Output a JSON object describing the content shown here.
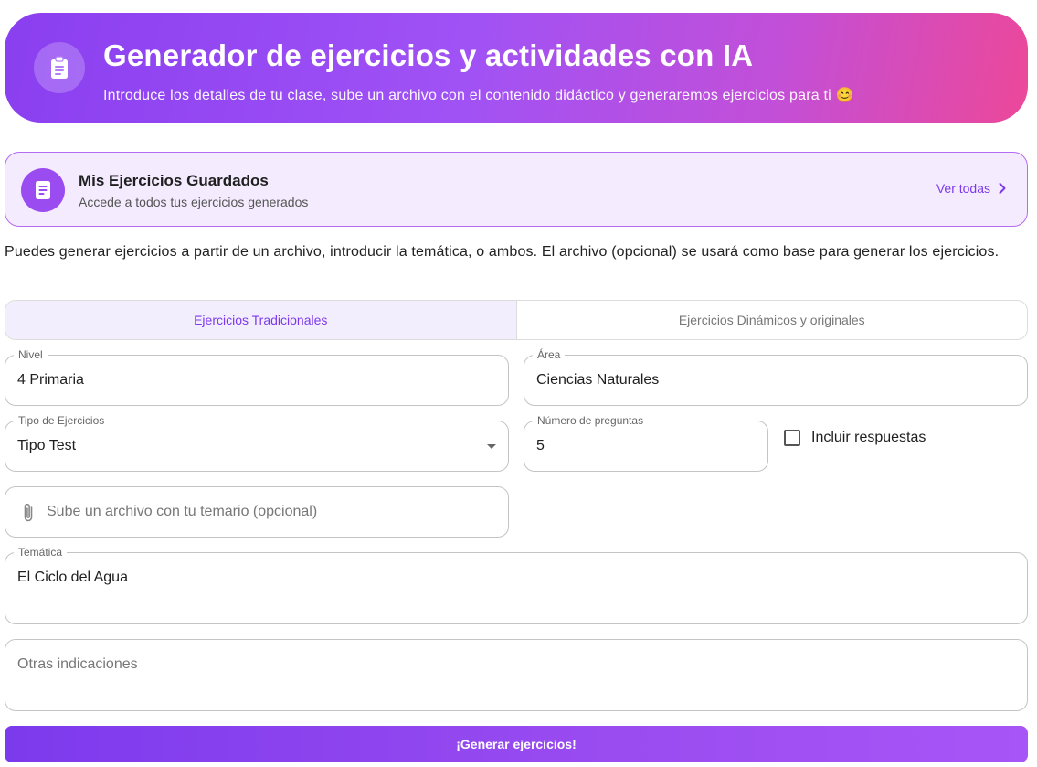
{
  "header": {
    "icon": "clipboard-icon",
    "title": "Generador de ejercicios y actividades con IA",
    "subtitle": "Introduce los detalles de tu clase, sube un archivo con el contenido didáctico y generaremos ejercicios para ti 😊",
    "gradient_start": "#8a3ff0",
    "gradient_end": "#ec4899"
  },
  "saved": {
    "icon": "document-icon",
    "title": "Mis Ejercicios Guardados",
    "subtitle": "Accede a todos tus ejercicios generados",
    "link_label": "Ver todas",
    "link_icon": "chevron-right-icon"
  },
  "intro_text": "Puedes generar ejercicios a partir de un archivo, introducir la temática, o ambos. El archivo (opcional) se usará como base para generar los ejercicios.",
  "tabs": [
    {
      "label": "Ejercicios Tradicionales",
      "active": true
    },
    {
      "label": "Ejercicios Dinámicos y originales",
      "active": false
    }
  ],
  "form": {
    "nivel": {
      "label": "Nivel",
      "value": "4 Primaria"
    },
    "area": {
      "label": "Área",
      "value": "Ciencias Naturales"
    },
    "tipo": {
      "label": "Tipo de Ejercicios",
      "value": "Tipo Test"
    },
    "numero": {
      "label": "Número de preguntas",
      "value": "5"
    },
    "incluir_respuestas": {
      "label": "Incluir respuestas",
      "checked": false
    },
    "archivo": {
      "placeholder": "Sube un archivo con tu temario (opcional)",
      "icon": "paperclip-icon"
    },
    "tematica": {
      "label": "Temática",
      "value": "El Ciclo del Agua"
    },
    "otras": {
      "placeholder": "Otras indicaciones"
    }
  },
  "submit_label": "¡Generar ejercicios!",
  "accent_color": "#7c3aed"
}
